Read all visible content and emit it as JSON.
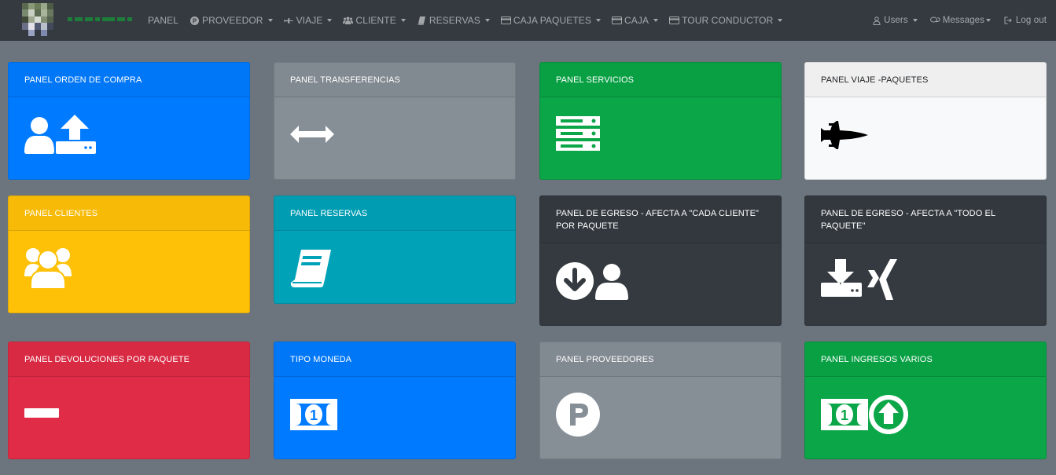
{
  "nav": {
    "brand": "PANEL",
    "items": [
      {
        "label": "PROVEEDOR",
        "icon": "p-circle-icon"
      },
      {
        "label": "VIAJE",
        "icon": "plane-icon"
      },
      {
        "label": "CLIENTE",
        "icon": "users-icon"
      },
      {
        "label": "RESERVAS",
        "icon": "book-icon"
      },
      {
        "label": "CAJA PAQUETES",
        "icon": "credit-card-icon"
      },
      {
        "label": "CAJA",
        "icon": "credit-card-icon"
      },
      {
        "label": "TOUR CONDUCTOR",
        "icon": "credit-card-icon"
      }
    ],
    "right": {
      "users": "Users",
      "messages": "Messages",
      "logout": "Log out"
    }
  },
  "cards": [
    {
      "title": "PANEL ORDEN DE COMPRA",
      "icon": "user-upload-icon",
      "color": "#007bff"
    },
    {
      "title": "PANEL TRANSFERENCIAS",
      "icon": "arrows-horizontal-icon",
      "color": "#868e96"
    },
    {
      "title": "PANEL SERVICIOS",
      "icon": "server-icon",
      "color": "#0aa647"
    },
    {
      "title": "PANEL VIAJE -PAQUETES",
      "icon": "fighter-jet-icon",
      "color": "#f8f9fa"
    },
    {
      "title": "PANEL CLIENTES",
      "icon": "users-icon",
      "color": "#ffc107"
    },
    {
      "title": "PANEL RESERVAS",
      "icon": "book-icon",
      "color": "#00a2b8"
    },
    {
      "title": "PANEL DE EGRESO - AFECTA A \"CADA CLIENTE\" POR PAQUETE",
      "icon": "arrow-down-user-icon",
      "color": "#343a40"
    },
    {
      "title": "PANEL DE EGRESO - AFECTA A \"TODO EL PAQUETE\"",
      "icon": "download-xing-icon",
      "color": "#343a40"
    },
    {
      "title": "PANEL DEVOLUCIONES POR PAQUETE",
      "icon": "minus-icon",
      "color": "#e12c47"
    },
    {
      "title": "TIPO MONEDA",
      "icon": "money-bill-icon",
      "color": "#007bff"
    },
    {
      "title": "PANEL PROVEEDORES",
      "icon": "parking-circle-icon",
      "color": "#868e96"
    },
    {
      "title": "PANEL INGRESOS VARIOS",
      "icon": "money-arrow-up-icon",
      "color": "#0aa647"
    }
  ]
}
